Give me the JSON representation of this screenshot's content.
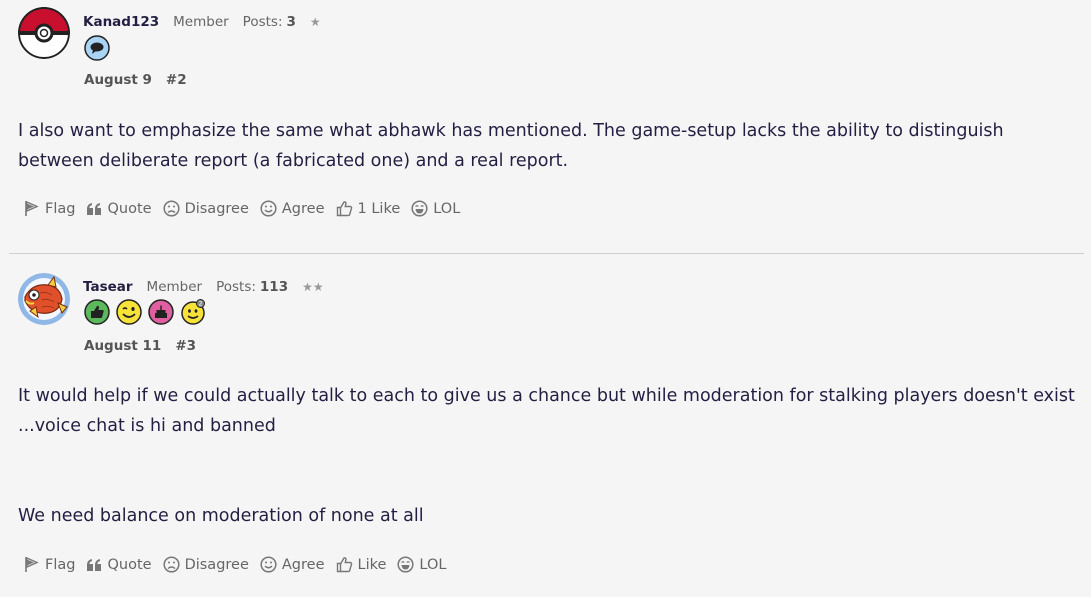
{
  "posts": [
    {
      "username": "Kanad123",
      "role": "Member",
      "posts_label": "Posts:",
      "posts_count": "3",
      "rank_stars": "★",
      "badges": [
        "comment-badge-icon"
      ],
      "date": "August 9",
      "post_number": "#2",
      "body": [
        "I also want to emphasize the same what abhawk has mentioned. The game-setup lacks the ability to distinguish between deliberate report (a fabricated one) and a real report."
      ],
      "actions": {
        "flag": "Flag",
        "quote": "Quote",
        "disagree": "Disagree",
        "agree": "Agree",
        "like": "1 Like",
        "lol": "LOL"
      }
    },
    {
      "username": "Tasear",
      "role": "Member",
      "posts_label": "Posts:",
      "posts_count": "113",
      "rank_stars": "★★",
      "badges": [
        "thumbs-up-badge-icon",
        "wink-badge-icon",
        "cake-badge-icon",
        "smile-badge-icon"
      ],
      "date": "August 11",
      "post_number": "#3",
      "body": [
        "It would help if we could actually talk to each to give us a chance but while moderation for stalking players doesn't exist ...voice chat is hi and banned",
        "We need balance on moderation of none at all"
      ],
      "actions": {
        "flag": "Flag",
        "quote": "Quote",
        "disagree": "Disagree",
        "agree": "Agree",
        "like": "Like",
        "lol": "LOL"
      }
    }
  ],
  "colors": {
    "background": "#f5f5f5",
    "text": "#231f42",
    "muted": "#666666",
    "divider": "#cfcfcf"
  }
}
